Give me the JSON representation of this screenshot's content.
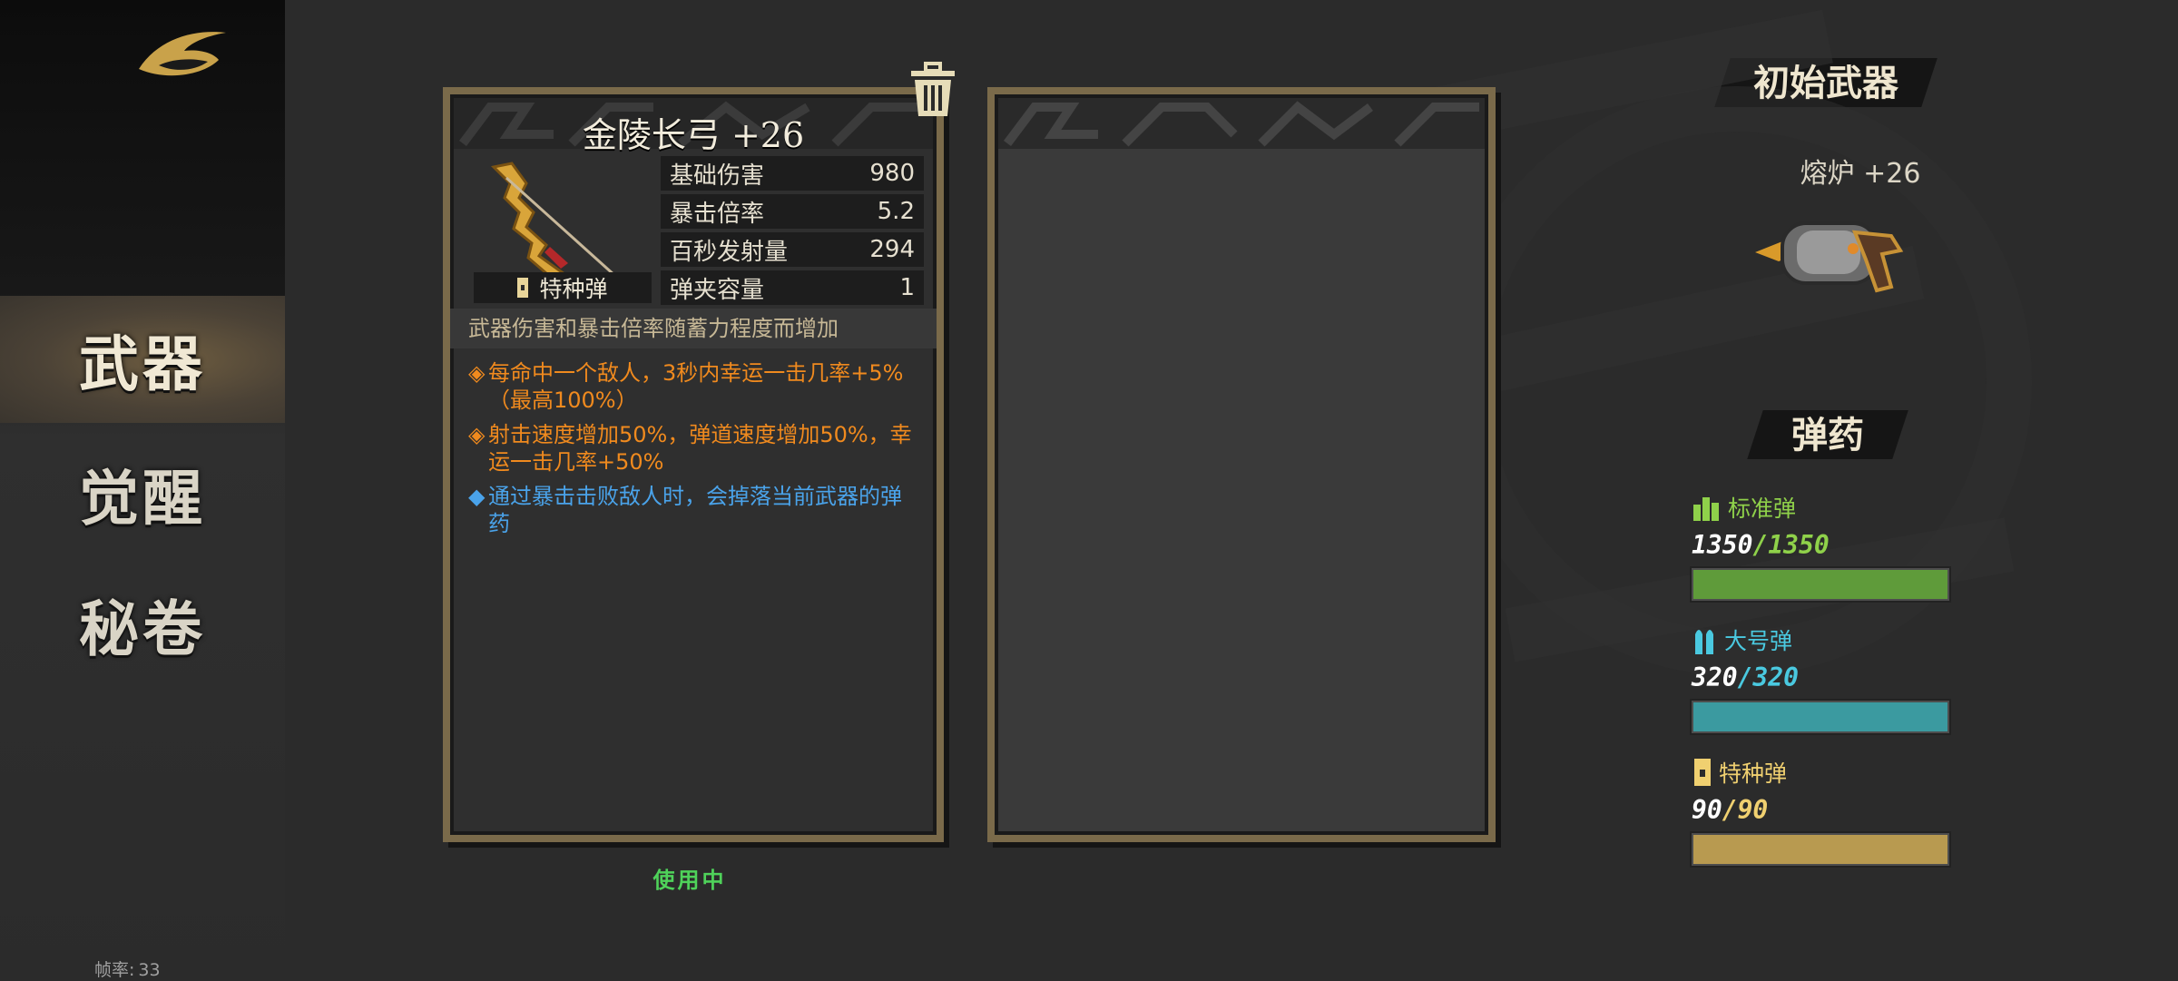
{
  "sidebar": {
    "nav": [
      {
        "label": "武器",
        "active": true
      },
      {
        "label": "觉醒",
        "active": false
      },
      {
        "label": "秘卷",
        "active": false
      }
    ],
    "fps_label": "帧率:",
    "fps_value": "33"
  },
  "weapon": {
    "title": "金陵长弓 +26",
    "ammo_type": "特种弹",
    "stats": [
      {
        "label": "基础伤害",
        "value": "980"
      },
      {
        "label": "暴击倍率",
        "value": "5.2"
      },
      {
        "label": "百秒发射量",
        "value": "294"
      },
      {
        "label": "弹夹容量",
        "value": "1"
      }
    ],
    "description": "武器伤害和暴击倍率随蓄力程度而增加",
    "effects": [
      {
        "marker": "◈",
        "text": "每命中一个敌人，3秒内幸运一击几率+5%（最高100%）",
        "color": "#f08a1e"
      },
      {
        "marker": "◈",
        "text": "射击速度增加50%，弹道速度增加50%，幸运一击几率+50%",
        "color": "#f08a1e"
      },
      {
        "marker": "◆",
        "text": "通过暴击击败敌人时，会掉落当前武器的弹药",
        "color": "#4aa3ea"
      }
    ],
    "status": "使用中",
    "trash_icon": "trash-icon"
  },
  "starting_weapon": {
    "heading": "初始武器",
    "name": "熔炉  +26"
  },
  "ammo": {
    "heading": "弹药",
    "types": [
      {
        "name": "标准弹",
        "current": "1350",
        "max": "1350",
        "label_color": "#8fd14a",
        "max_color": "#8fd14a",
        "bar_color": "#5f9b3a",
        "fill": 1.0,
        "icon": "standard-ammo-icon"
      },
      {
        "name": "大号弹",
        "current": "320",
        "max": "320",
        "label_color": "#4ac9e0",
        "max_color": "#4ac9e0",
        "bar_color": "#3b9aa0",
        "fill": 1.0,
        "icon": "large-ammo-icon"
      },
      {
        "name": "特种弹",
        "current": "90",
        "max": "90",
        "label_color": "#f0d070",
        "max_color": "#f0d070",
        "bar_color": "#b89a50",
        "fill": 1.0,
        "icon": "special-ammo-icon"
      }
    ]
  }
}
